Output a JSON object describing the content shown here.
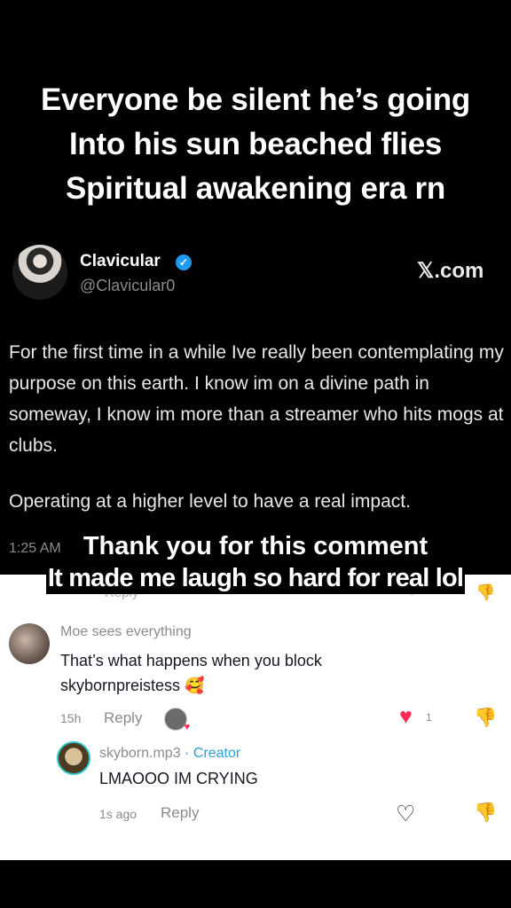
{
  "caption": {
    "line1": "Everyone be silent he’s going",
    "line2": "Into his sun beached flies",
    "line3": "Spiritual awakening era rn"
  },
  "tweet": {
    "name": "Clavicular",
    "handle": "@Clavicular0",
    "source": "𝕏.com",
    "paragraph1": "For the first time in a while Ive really been contemplating my purpose on this earth. I know im on a divine path in someway, I know im more than a streamer who hits mogs at clubs.",
    "paragraph2": "Operating at a higher level to have a real impact.",
    "time": "1:25 AM"
  },
  "overlay": {
    "line1": "Thank you for this comment",
    "line2": "It made me laugh so hard for real lol"
  },
  "comments": [
    {
      "user": "Moe sees everything",
      "text": "That’s what happens when you block skybornpreistess",
      "emoji": "🥰",
      "time": "15h",
      "reply_label": "Reply",
      "likes": "1"
    },
    {
      "user": "skyborn.mp3",
      "badge": "· Creator",
      "text": "LMAOOO IM CRYING",
      "time": "1s ago",
      "reply_label": "Reply"
    }
  ],
  "ghost_reply": "Reply",
  "icons": {
    "heart": "heart-icon",
    "dislike": "dislike-icon",
    "verified": "verified-badge-icon"
  },
  "colors": {
    "like_red": "#fe2c55",
    "creator_blue": "#2a9fd8",
    "verified_blue": "#1d9bf0"
  }
}
